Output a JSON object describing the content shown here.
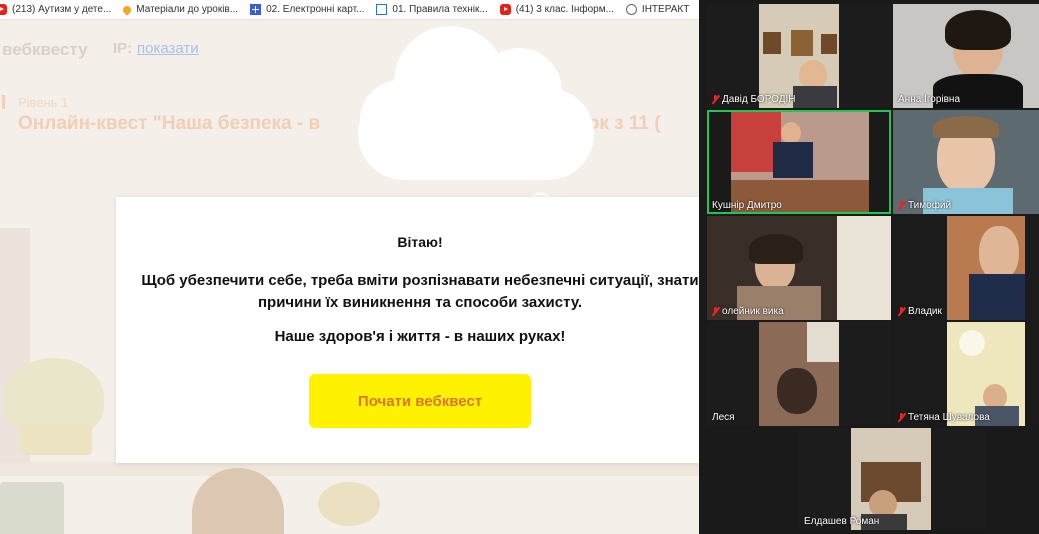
{
  "bookmarks": [
    {
      "label": "(213) Аутизм у дете...",
      "icon": "youtube-icon"
    },
    {
      "label": "Матеріали до уроків...",
      "icon": "pin-icon"
    },
    {
      "label": "02. Електронні карт...",
      "icon": "grid-icon"
    },
    {
      "label": "01. Правила технік...",
      "icon": "doc-icon"
    },
    {
      "label": "(41) 3 клас. Інформ...",
      "icon": "youtube-icon"
    },
    {
      "label": "ІНТЕРАКТ",
      "icon": "globe-icon"
    }
  ],
  "page": {
    "site_title": "вебквесту",
    "ip_label": "IP:",
    "ip_link": "показати",
    "level_label": "Рівень 1",
    "quest_title_left": "Онлайн-квест \"Наша безпека - в",
    "quest_title_right": "азок з 11  ("
  },
  "dialog": {
    "greeting": "Вітаю!",
    "message": "Щоб убезпечити себе, треба вміти розпізнавати небезпечні ситуації, знати причини їх виникнення та способи захисту.",
    "tagline": "Наше здоров'я і життя - в наших руках!",
    "start_button": "Почати вебквест"
  },
  "participants": [
    {
      "name": "Давід БОРОДІН",
      "muted": true,
      "active": false
    },
    {
      "name": "Анна Ігорівна",
      "muted": false,
      "active": false
    },
    {
      "name": "Кушнір Дмитро",
      "muted": false,
      "active": true
    },
    {
      "name": "Тимофий",
      "muted": true,
      "active": false
    },
    {
      "name": "олейник вика",
      "muted": true,
      "active": false
    },
    {
      "name": "Владик",
      "muted": true,
      "active": false
    },
    {
      "name": "Леся",
      "muted": false,
      "active": false
    },
    {
      "name": "Тетяна Шувалова",
      "muted": true,
      "active": false
    },
    {
      "name": "Елдашев Роман",
      "muted": false,
      "active": false
    }
  ],
  "colors": {
    "start_button_bg": "#fff200",
    "start_button_text": "#d9772b",
    "active_speaker_border": "#23c552",
    "muted_icon": "#e02828"
  }
}
